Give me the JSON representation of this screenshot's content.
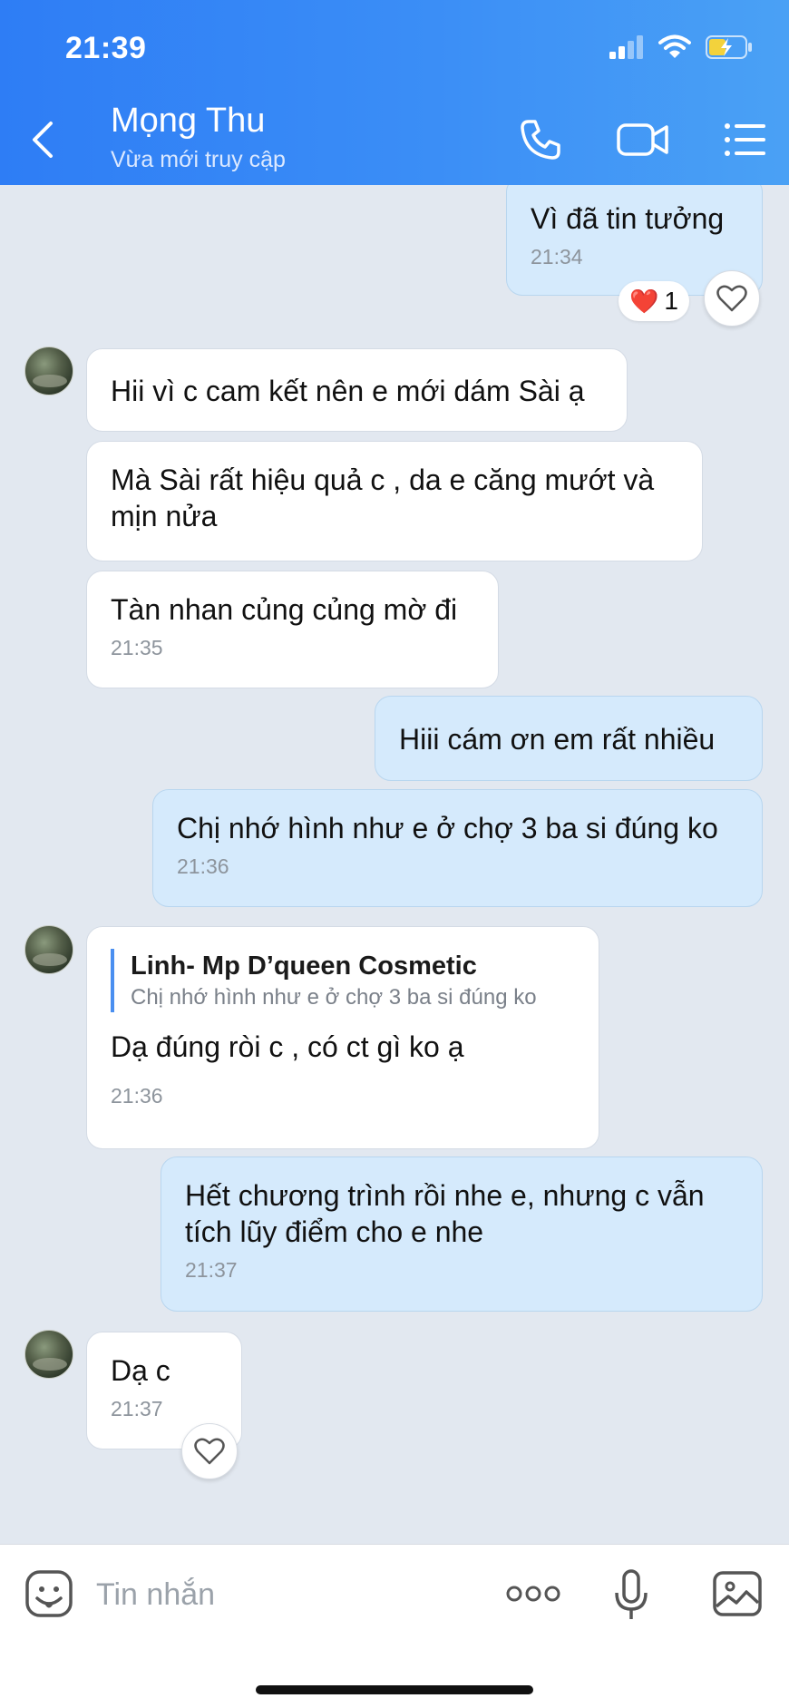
{
  "status_bar": {
    "time": "21:39"
  },
  "header": {
    "contact_name": "Mọng Thu",
    "status": "Vừa mới truy cập"
  },
  "messages": [
    {
      "dir": "out",
      "text": "Vì đã tin tưởng",
      "time": "21:34",
      "reaction": {
        "emoji": "❤️",
        "count": "1"
      }
    },
    {
      "dir": "in",
      "text": "Hii vì c cam kết nên e mới dám Sài ạ"
    },
    {
      "dir": "in",
      "text": "Mà Sài rất hiệu quả c , da e căng mướt và\nmịn nửa"
    },
    {
      "dir": "in",
      "text": "Tàn nhan củng củng mờ đi",
      "time": "21:35"
    },
    {
      "dir": "out",
      "text": "Hiii cám ơn em rất nhiều"
    },
    {
      "dir": "out",
      "text": "Chị nhớ hình như e ở chợ 3 ba si đúng ko",
      "time": "21:36"
    },
    {
      "dir": "in",
      "quote": {
        "name": "Linh- Mp D’queen Cosmetic",
        "text": "Chị nhớ hình như e ở chợ 3 ba si đúng ko"
      },
      "text": "Dạ đúng ròi c , có ct gì ko ạ",
      "time": "21:36"
    },
    {
      "dir": "out",
      "text": "Hết chương trình rồi nhe e, nhưng c vẫn\ntích lũy điểm cho e nhe",
      "time": "21:37"
    },
    {
      "dir": "in",
      "text": "Dạ c",
      "time": "21:37"
    }
  ],
  "input_bar": {
    "placeholder": "Tin nhắn"
  },
  "colors": {
    "header": "#3b8ef6",
    "outgoing_bubble": "#d5eafc",
    "incoming_bubble": "#ffffff",
    "background": "#e2e8f0"
  }
}
